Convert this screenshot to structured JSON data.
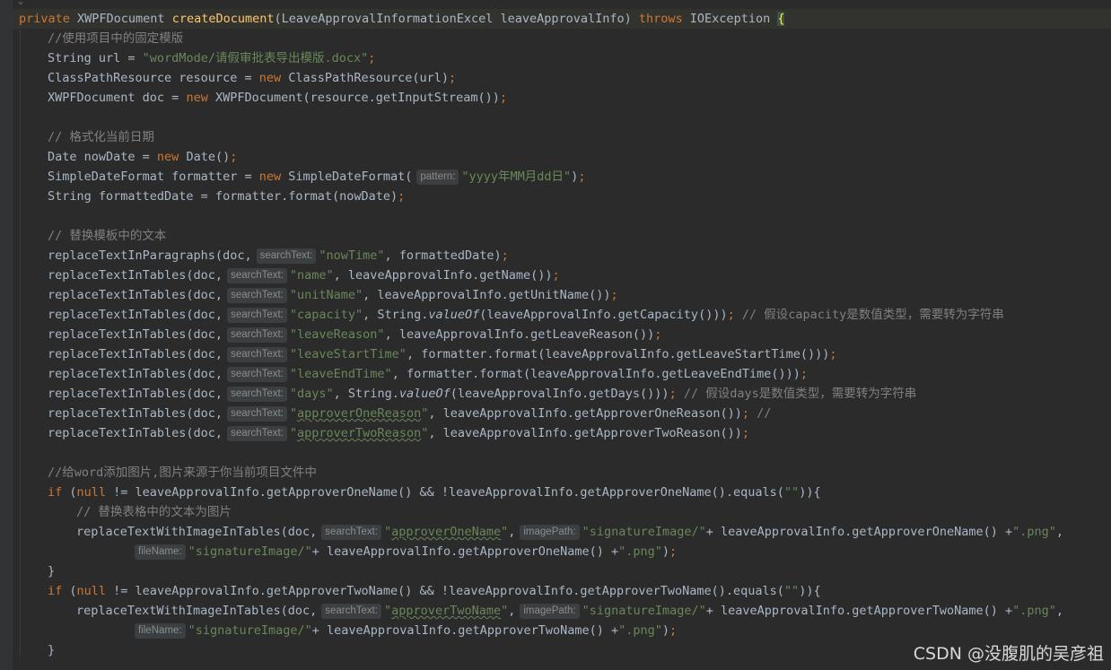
{
  "code": {
    "l1": {
      "a": "private ",
      "b": "XWPFDocument ",
      "c": "createDocument",
      "d": "(LeaveApprovalInformationExcel leaveApprovalInfo) ",
      "e": "throws ",
      "f": "IOException ",
      "g": "{"
    },
    "l2": {
      "a": "//使用项目中的固定模版"
    },
    "l3": {
      "a": "String url = ",
      "b": "\"wordMode/请假审批表导出模版.docx\"",
      "c": ";"
    },
    "l4": {
      "a": "ClassPathResource resource = ",
      "b": "new ",
      "c": "ClassPathResource(url)",
      "d": ";"
    },
    "l5": {
      "a": "XWPFDocument doc = ",
      "b": "new ",
      "c": "XWPFDocument(resource.getInputStream())",
      "d": ";"
    },
    "l6": {
      "a": "// 格式化当前日期"
    },
    "l7": {
      "a": "Date nowDate = ",
      "b": "new ",
      "c": "Date()",
      "d": ";"
    },
    "l8": {
      "a": "SimpleDateFormat formatter = ",
      "b": "new ",
      "c": "SimpleDateFormat(",
      "h": "pattern:",
      "s": "\"yyyy年MM月dd日\"",
      "d": ")",
      ";": ";"
    },
    "l9": {
      "a": "String formattedDate = formatter.format(nowDate)",
      "b": ";"
    },
    "l10": {
      "a": "// 替换模板中的文本"
    },
    "l11": {
      "a": "replaceTextInParagraphs(doc,",
      "h": "searchText:",
      "s": "\"nowTime\"",
      "c": ", formattedDate)",
      "d": ";"
    },
    "l12": {
      "a": "replaceTextInTables(doc,",
      "h": "searchText:",
      "s": "\"name\"",
      "c": ", leaveApprovalInfo.getName())",
      "d": ";"
    },
    "l13": {
      "a": "replaceTextInTables(doc,",
      "h": "searchText:",
      "s": "\"unitName\"",
      "c": ", leaveApprovalInfo.getUnitName())",
      "d": ";"
    },
    "l14": {
      "a": "replaceTextInTables(doc,",
      "h": "searchText:",
      "s": "\"capacity\"",
      "c": ", String.",
      "m": "valueOf",
      "e": "(leaveApprovalInfo.getCapacity()))",
      "d": ";",
      "cm": " // 假设capacity是数值类型，需要转为字符串"
    },
    "l15": {
      "a": "replaceTextInTables(doc,",
      "h": "searchText:",
      "s": "\"leaveReason\"",
      "c": ", leaveApprovalInfo.getLeaveReason())",
      "d": ";"
    },
    "l16": {
      "a": "replaceTextInTables(doc,",
      "h": "searchText:",
      "s": "\"leaveStartTime\"",
      "c": ", formatter.format(leaveApprovalInfo.getLeaveStartTime()))",
      "d": ";"
    },
    "l17": {
      "a": "replaceTextInTables(doc,",
      "h": "searchText:",
      "s": "\"leaveEndTime\"",
      "c": ", formatter.format(leaveApprovalInfo.getLeaveEndTime()))",
      "d": ";"
    },
    "l18": {
      "a": "replaceTextInTables(doc,",
      "h": "searchText:",
      "s": "\"days\"",
      "c": ", String.",
      "m": "valueOf",
      "e": "(leaveApprovalInfo.getDays()))",
      "d": ";",
      "cm": " // 假设days是数值类型，需要转为字符串"
    },
    "l19": {
      "a": "replaceTextInTables(doc,",
      "h": "searchText:",
      "s1": "\"",
      "sq": "approverOneReason",
      "s2": "\"",
      "c": ", leaveApprovalInfo.getApproverOneReason())",
      "d": ";",
      "cm": " //"
    },
    "l20": {
      "a": "replaceTextInTables(doc,",
      "h": "searchText:",
      "s1": "\"",
      "sq": "approverTwoReason",
      "s2": "\"",
      "c": ", leaveApprovalInfo.getApproverTwoReason())",
      "d": ";"
    },
    "l21": {
      "a": "//给word添加图片,图片来源于你当前项目文件中"
    },
    "l22": {
      "k": "if ",
      "a": "(",
      "n": "null ",
      "b": "!= leaveApprovalInfo.getApproverOneName() && !leaveApprovalInfo.getApproverOneName().equals(",
      "s": "\"\"",
      "c": ")){"
    },
    "l23": {
      "a": "// 替换表格中的文本为图片"
    },
    "l24": {
      "a": "replaceTextWithImageInTables(doc,",
      "h": "searchText:",
      "s1": "\"",
      "sq": "approverOneName",
      "s2": "\"",
      "c": ",",
      "h2": "imagePath:",
      "s3": "\"signatureImage/\"",
      "e": "+ leaveApprovalInfo.getApproverOneName() +",
      "s4": "\".png\"",
      "f": ","
    },
    "l25": {
      "h": "fileName:",
      "s": "\"signatureImage/\"",
      "a": "+ leaveApprovalInfo.getApproverOneName() +",
      "s2": "\".png\"",
      "b": ")",
      ";": ";"
    },
    "l26": {
      "a": "}"
    },
    "l27": {
      "k": "if ",
      "a": "(",
      "n": "null ",
      "b": "!= leaveApprovalInfo.getApproverTwoName() && !leaveApprovalInfo.getApproverTwoName().equals(",
      "s": "\"\"",
      "c": ")){"
    },
    "l28": {
      "a": "replaceTextWithImageInTables(doc,",
      "h": "searchText:",
      "s1": "\"",
      "sq": "approverTwoName",
      "s2": "\"",
      "c": ",",
      "h2": "imagePath:",
      "s3": "\"signatureImage/\"",
      "e": "+ leaveApprovalInfo.getApproverTwoName() +",
      "s4": "\".png\"",
      "f": ","
    },
    "l29": {
      "h": "fileName:",
      "s": "\"signatureImage/\"",
      "a": "+ leaveApprovalInfo.getApproverTwoName() +",
      "s2": "\".png\"",
      "b": ")",
      ";": ";"
    },
    "l30": {
      "a": "}"
    }
  },
  "watermark": "CSDN @没腹肌的吴彦祖",
  "colors": {
    "background": "#2b2b2b",
    "keyword": "#cc7832",
    "method_decl": "#ffc66d",
    "string": "#6a8759",
    "comment": "#808080",
    "text": "#a9b7c6"
  }
}
